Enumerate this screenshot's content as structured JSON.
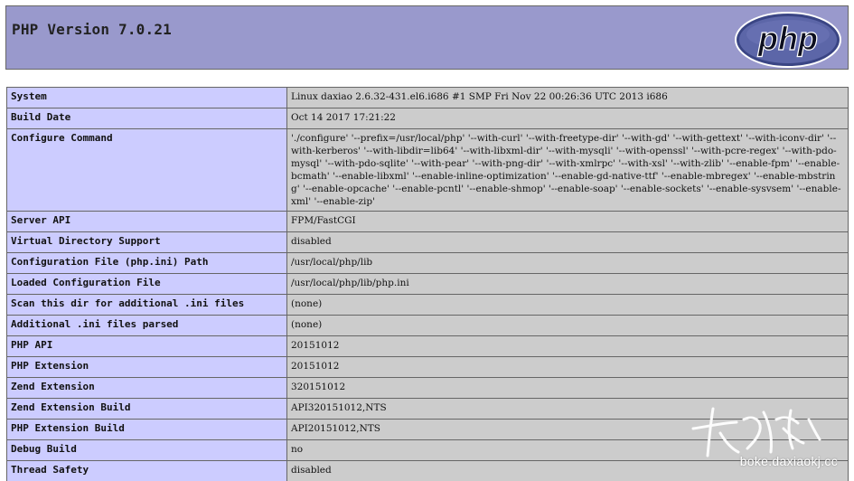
{
  "header": {
    "title": "PHP Version 7.0.21",
    "logo_text": "php"
  },
  "rows": [
    {
      "key": "System",
      "value": "Linux daxiao 2.6.32-431.el6.i686 #1 SMP Fri Nov 22 00:26:36 UTC 2013 i686"
    },
    {
      "key": "Build Date",
      "value": "Oct 14 2017 17:21:22"
    },
    {
      "key": "Configure Command",
      "value": "'./configure' '--prefix=/usr/local/php' '--with-curl' '--with-freetype-dir' '--with-gd' '--with-gettext' '--with-iconv-dir' '--with-kerberos' '--with-libdir=lib64' '--with-libxml-dir' '--with-mysqli' '--with-openssl' '--with-pcre-regex' '--with-pdo-mysql' '--with-pdo-sqlite' '--with-pear' '--with-png-dir' '--with-xmlrpc' '--with-xsl' '--with-zlib' '--enable-fpm' '--enable-bcmath' '--enable-libxml' '--enable-inline-optimization' '--enable-gd-native-ttf' '--enable-mbregex' '--enable-mbstring' '--enable-opcache' '--enable-pcntl' '--enable-shmop' '--enable-soap' '--enable-sockets' '--enable-sysvsem' '--enable-xml' '--enable-zip'"
    },
    {
      "key": "Server API",
      "value": "FPM/FastCGI"
    },
    {
      "key": "Virtual Directory Support",
      "value": "disabled"
    },
    {
      "key": "Configuration File (php.ini) Path",
      "value": "/usr/local/php/lib"
    },
    {
      "key": "Loaded Configuration File",
      "value": "/usr/local/php/lib/php.ini"
    },
    {
      "key": "Scan this dir for additional .ini files",
      "value": "(none)"
    },
    {
      "key": "Additional .ini files parsed",
      "value": "(none)"
    },
    {
      "key": "PHP API",
      "value": "20151012"
    },
    {
      "key": "PHP Extension",
      "value": "20151012"
    },
    {
      "key": "Zend Extension",
      "value": "320151012"
    },
    {
      "key": "Zend Extension Build",
      "value": "API320151012,NTS"
    },
    {
      "key": "PHP Extension Build",
      "value": "API20151012,NTS"
    },
    {
      "key": "Debug Build",
      "value": "no"
    },
    {
      "key": "Thread Safety",
      "value": "disabled"
    }
  ],
  "watermark": {
    "text": "boke.daxiaokj.cc"
  },
  "colors": {
    "header_bg": "#9999cc",
    "key_bg": "#ccccff",
    "value_bg": "#cccccc",
    "border": "#666666"
  }
}
